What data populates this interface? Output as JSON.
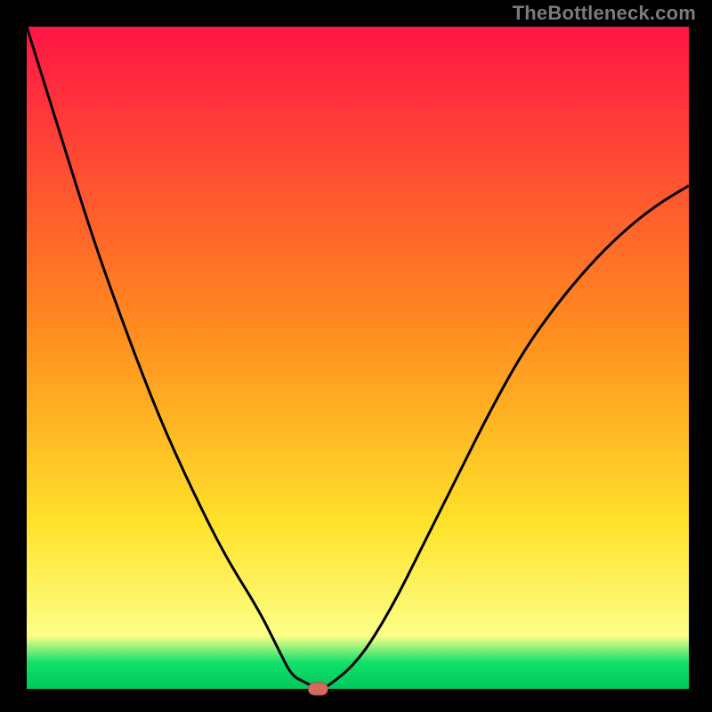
{
  "watermark": "TheBottleneck.com",
  "colors": {
    "black": "#000000",
    "curve": "#000000",
    "marker_fill": "#d26a5f",
    "marker_stroke": "#b34e44",
    "grad_top": "#ff1545",
    "grad_mid1": "#ff8a1f",
    "grad_mid2": "#ffe22a",
    "grad_mid3": "#fcff88",
    "grad_low": "#12e06a",
    "grad_bottom": "#00c95c"
  },
  "chart_data": {
    "type": "line",
    "title": "",
    "xlabel": "",
    "ylabel": "",
    "xlim": [
      0,
      100
    ],
    "ylim": [
      0,
      100
    ],
    "x": [
      0,
      5,
      10,
      15,
      20,
      25,
      30,
      35,
      38,
      40,
      42,
      44,
      45,
      50,
      55,
      60,
      65,
      70,
      75,
      80,
      85,
      90,
      95,
      100
    ],
    "values": [
      100,
      84,
      68,
      54,
      41,
      30,
      20,
      12,
      6,
      2,
      1,
      0,
      0,
      4,
      12,
      22,
      32,
      42,
      51,
      58,
      64,
      69,
      73,
      76
    ],
    "marker": {
      "x": 44,
      "y": 0
    },
    "gradient_stops": [
      {
        "pos": 0.0,
        "value": 100
      },
      {
        "pos": 0.45,
        "value": 55
      },
      {
        "pos": 0.75,
        "value": 25
      },
      {
        "pos": 0.92,
        "value": 8
      },
      {
        "pos": 0.96,
        "value": 4
      },
      {
        "pos": 1.0,
        "value": 0
      }
    ]
  }
}
